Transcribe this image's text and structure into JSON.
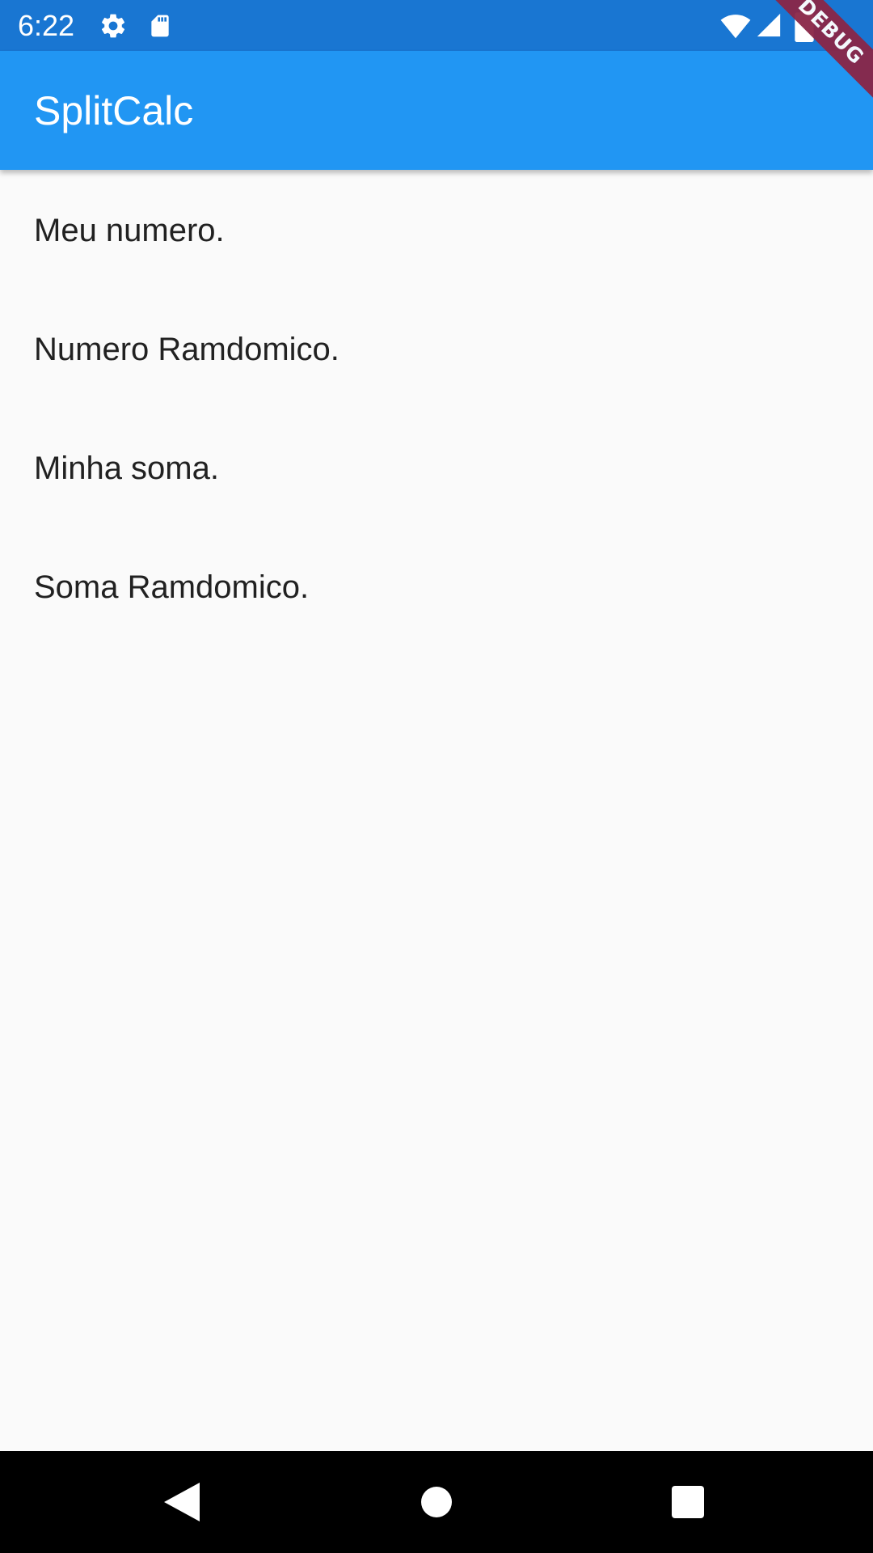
{
  "status_bar": {
    "time": "6:22",
    "icons": [
      "gear-icon",
      "sd-card-icon",
      "wifi-icon",
      "signal-icon",
      "battery-icon"
    ],
    "background": "#1976d2"
  },
  "app_bar": {
    "title": "SplitCalc",
    "background": "#2196f3"
  },
  "debug_banner": {
    "label": "DEBUG"
  },
  "content": {
    "lines": [
      "Meu numero.",
      "Numero Ramdomico.",
      "Minha soma.",
      "Soma Ramdomico."
    ]
  },
  "nav_bar": {
    "buttons": [
      "back-icon",
      "home-icon",
      "recents-icon"
    ]
  }
}
